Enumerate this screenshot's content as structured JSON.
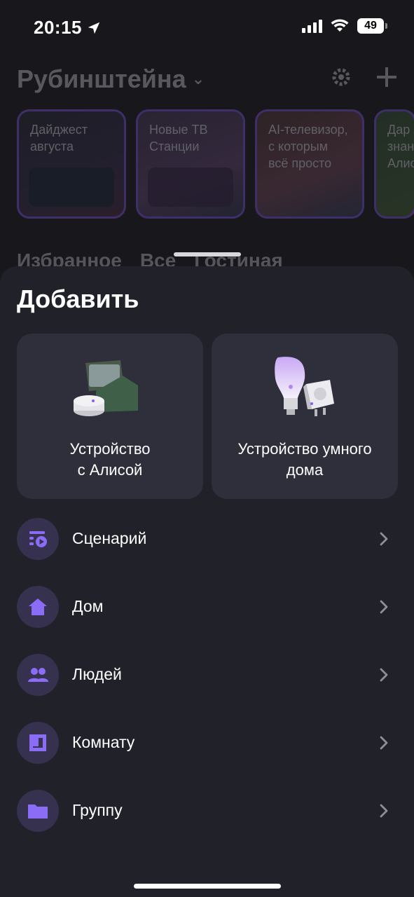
{
  "status_bar": {
    "time": "20:15",
    "battery": "49"
  },
  "background": {
    "home_title": "Рубинштейна",
    "stories": [
      {
        "text": "Дайджест августа"
      },
      {
        "text": "Новые ТВ Станции"
      },
      {
        "text": "AI-телевизор, с которым всё просто"
      },
      {
        "text": "Дар знан Алис"
      }
    ],
    "tabs": [
      "Избранное",
      "Все",
      "Гостиная"
    ]
  },
  "sheet": {
    "title": "Добавить",
    "cards": [
      {
        "label": "Устройство\nс Алисой",
        "icon": "smart-speaker-illustration"
      },
      {
        "label": "Устройство умного\nдома",
        "icon": "smart-bulb-plug-illustration"
      }
    ],
    "items": [
      {
        "label": "Сценарий",
        "icon": "scenario-icon"
      },
      {
        "label": "Дом",
        "icon": "house-icon"
      },
      {
        "label": "Людей",
        "icon": "people-icon"
      },
      {
        "label": "Комнату",
        "icon": "room-icon"
      },
      {
        "label": "Группу",
        "icon": "folder-icon"
      }
    ]
  },
  "colors": {
    "accent": "#8b5cf6",
    "icon_bg": "#35314e",
    "sheet_bg": "#212129",
    "card_bg": "#2e2f3a"
  }
}
